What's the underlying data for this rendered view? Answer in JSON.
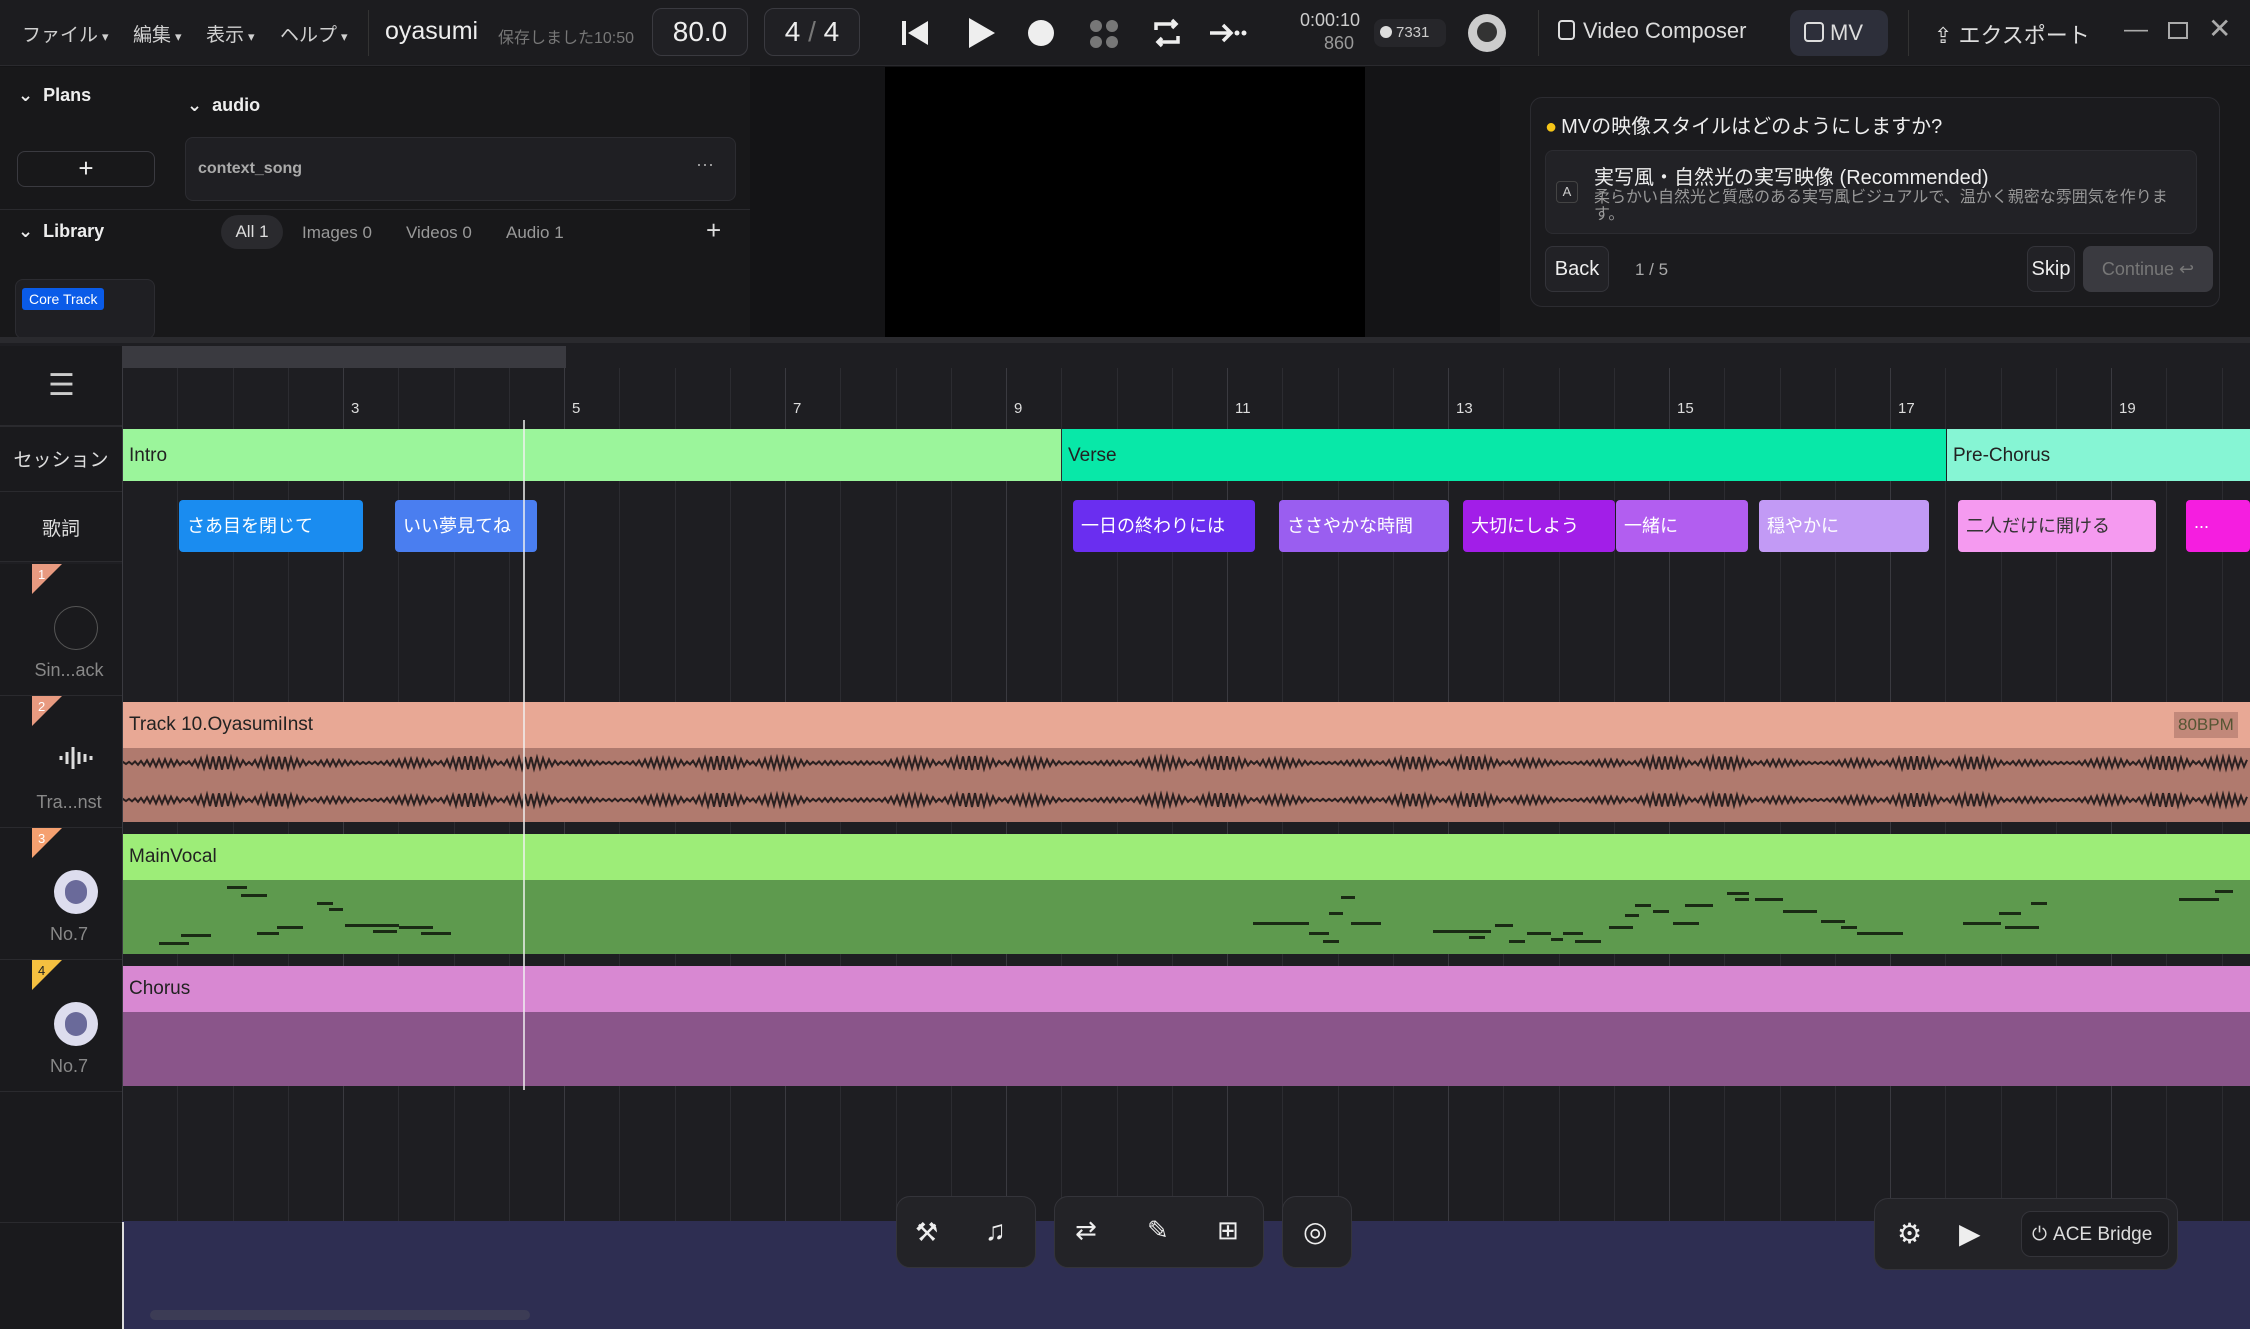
{
  "menu": {
    "file": "ファイル",
    "edit": "編集",
    "view": "表示",
    "help": "ヘルプ"
  },
  "project": {
    "name": "oyasumi",
    "saved": "保存しました10:50"
  },
  "transport": {
    "bpm": "80.0",
    "sig_num": "4",
    "sig_sep": "/",
    "sig_den": "4",
    "time": "0:00:10",
    "samples": "860",
    "credits": "7331"
  },
  "tabs": {
    "video_composer": "Video Composer",
    "mv": "MV",
    "export": "エクスポート"
  },
  "plans": {
    "title": "Plans",
    "add": "+",
    "audio_group": "audio",
    "song": "context_song",
    "more": "···"
  },
  "library": {
    "title": "Library",
    "filters": [
      "All 1",
      "Images 0",
      "Videos 0",
      "Audio 1"
    ],
    "add": "+",
    "badge": "Core Track"
  },
  "question": {
    "title": "MVの映像スタイルはどのようにしますか?",
    "option_key": "A",
    "option_title": "実写風・自然光の実写映像 (Recommended)",
    "option_desc": "柔らかい自然光と質感のある実写風ビジュアルで、温かく親密な雰囲気を作ります。",
    "back": "Back",
    "progress": "1 / 5",
    "skip": "Skip",
    "continue": "Continue ↩"
  },
  "ruler": {
    "labels": [
      "3",
      "5",
      "7",
      "9",
      "11",
      "13",
      "15",
      "17",
      "19"
    ]
  },
  "rows": {
    "session": "セッション",
    "lyrics": "歌詞"
  },
  "sections": [
    {
      "label": "Intro",
      "color": "#9bf59b"
    },
    {
      "label": "Verse",
      "color": "#08e8a8"
    },
    {
      "label": "Pre-Chorus",
      "color": "#86f5d4"
    }
  ],
  "lyrics": [
    {
      "text": "さあ目を閉じて",
      "color": "#1a8cf0"
    },
    {
      "text": "いい夢見てね",
      "color": "#4a7ef0"
    },
    {
      "text": "一日の終わりには",
      "color": "#6a2ef0"
    },
    {
      "text": "ささやかな時間",
      "color": "#9a5ef0"
    },
    {
      "text": "大切にしよう",
      "color": "#a21ee8"
    },
    {
      "text": "一緒に",
      "color": "#b25ef0"
    },
    {
      "text": "穏やかに",
      "color": "#c29af5"
    },
    {
      "text": "二人だけに開ける",
      "color": "#f59af0"
    },
    {
      "text": "...",
      "color": "#f51ee0"
    }
  ],
  "tracks": [
    {
      "num": "1",
      "name": "Sin...ack",
      "clip": ""
    },
    {
      "num": "2",
      "name": "Tra...nst",
      "clip": "Track 10.OyasumiInst",
      "bpm": "80BPM"
    },
    {
      "num": "3",
      "name": "No.7",
      "clip": "MainVocal"
    },
    {
      "num": "4",
      "name": "No.7",
      "clip": "Chorus"
    }
  ],
  "bottom": {
    "ace": "ACE Bridge"
  },
  "colors": {
    "inst": "#e8a895",
    "inst_body": "#b07a6e",
    "vocal": "#9ded78",
    "vocal_body": "#5e9a4e",
    "chorus": "#d888d2",
    "chorus_body": "#8a558a",
    "accent": "#0a5be8"
  }
}
